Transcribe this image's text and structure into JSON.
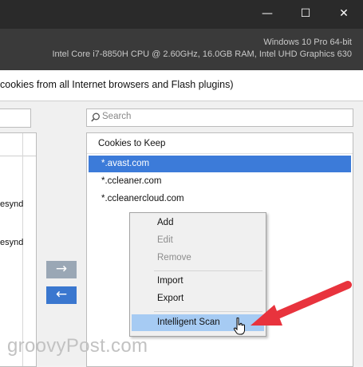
{
  "window": {
    "controls": {
      "minimize": "—",
      "maximize": "☐",
      "close": "✕"
    },
    "system_info": {
      "line1": "Windows 10 Pro 64-bit",
      "line2": "Intel Core i7-8850H CPU @ 2.60GHz, 16.0GB RAM, Intel UHD Graphics 630"
    }
  },
  "description": "cookies from all Internet browsers and Flash plugins)",
  "left_panel": {
    "items": [
      "esynd",
      "esynd"
    ]
  },
  "move_buttons": {
    "right": "→",
    "left": "←"
  },
  "right_panel": {
    "search_placeholder": "Search",
    "title": "Cookies to Keep",
    "items": [
      "*.avast.com",
      "*.ccleaner.com",
      "*.ccleanercloud.com"
    ],
    "selected_index": 0
  },
  "context_menu": {
    "items": [
      {
        "label": "Add",
        "enabled": true
      },
      {
        "label": "Edit",
        "enabled": false
      },
      {
        "label": "Remove",
        "enabled": false
      },
      {
        "label": "Import",
        "enabled": true
      },
      {
        "label": "Export",
        "enabled": true
      },
      {
        "label": "Intelligent Scan",
        "enabled": true,
        "highlighted": true
      }
    ]
  },
  "watermark": "groovyPost.com",
  "colors": {
    "selection": "#3c7bd9",
    "menu_highlight": "#a6cbf3",
    "move_right_button": "#9aa7b5",
    "move_left_button": "#3a77cf",
    "annotation_arrow": "#e8333d"
  }
}
